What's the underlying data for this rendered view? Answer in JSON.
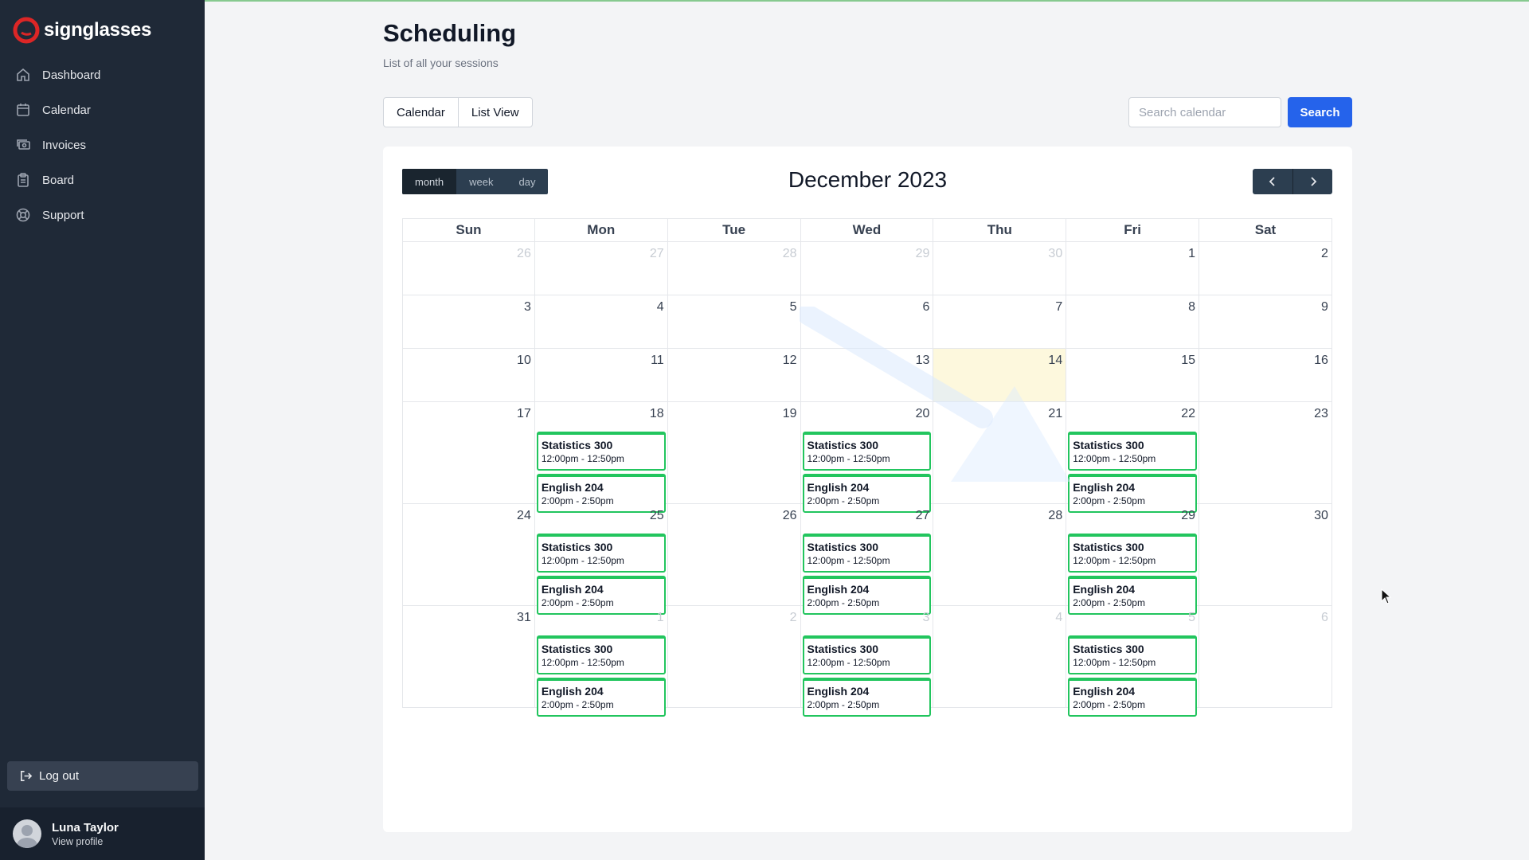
{
  "app": {
    "brand": "signglasses",
    "brand_color": "#dc2626"
  },
  "sidebar": {
    "items": [
      {
        "label": "Dashboard",
        "icon": "home-icon"
      },
      {
        "label": "Calendar",
        "icon": "calendar-icon"
      },
      {
        "label": "Invoices",
        "icon": "invoice-icon"
      },
      {
        "label": "Board",
        "icon": "clipboard-icon"
      },
      {
        "label": "Support",
        "icon": "lifebuoy-icon"
      }
    ],
    "logout_label": "Log out",
    "user": {
      "name": "Luna Taylor",
      "link": "View profile"
    }
  },
  "header": {
    "title": "Scheduling",
    "subtitle": "List of all your sessions"
  },
  "toolbar": {
    "views": [
      "Calendar",
      "List View"
    ],
    "search_placeholder": "Search calendar",
    "search_label": "Search",
    "accent": "#2563eb"
  },
  "calendar": {
    "month_title": "December 2023",
    "range_tabs": [
      "month",
      "week",
      "day"
    ],
    "active_range": "month",
    "weekdays": [
      "Sun",
      "Mon",
      "Tue",
      "Wed",
      "Thu",
      "Fri",
      "Sat"
    ],
    "today": 14,
    "event_color": "#22c55e",
    "event_types": {
      "stats": {
        "title": "Statistics 300",
        "time": "12:00pm - 12:50pm"
      },
      "english": {
        "title": "English 204",
        "time": "2:00pm - 2:50pm"
      }
    },
    "weeks": [
      [
        {
          "d": "26",
          "other": true
        },
        {
          "d": "27",
          "other": true
        },
        {
          "d": "28",
          "other": true
        },
        {
          "d": "29",
          "other": true
        },
        {
          "d": "30",
          "other": true
        },
        {
          "d": "1"
        },
        {
          "d": "2"
        }
      ],
      [
        {
          "d": "3"
        },
        {
          "d": "4"
        },
        {
          "d": "5"
        },
        {
          "d": "6"
        },
        {
          "d": "7"
        },
        {
          "d": "8"
        },
        {
          "d": "9"
        }
      ],
      [
        {
          "d": "10"
        },
        {
          "d": "11"
        },
        {
          "d": "12"
        },
        {
          "d": "13"
        },
        {
          "d": "14",
          "today": true
        },
        {
          "d": "15"
        },
        {
          "d": "16"
        }
      ],
      [
        {
          "d": "17"
        },
        {
          "d": "18",
          "ev": [
            "stats",
            "english"
          ]
        },
        {
          "d": "19"
        },
        {
          "d": "20",
          "ev": [
            "stats",
            "english"
          ]
        },
        {
          "d": "21"
        },
        {
          "d": "22",
          "ev": [
            "stats",
            "english"
          ]
        },
        {
          "d": "23"
        }
      ],
      [
        {
          "d": "24"
        },
        {
          "d": "25",
          "ev": [
            "stats",
            "english"
          ]
        },
        {
          "d": "26"
        },
        {
          "d": "27",
          "ev": [
            "stats",
            "english"
          ]
        },
        {
          "d": "28"
        },
        {
          "d": "29",
          "ev": [
            "stats",
            "english"
          ]
        },
        {
          "d": "30"
        }
      ],
      [
        {
          "d": "31"
        },
        {
          "d": "1",
          "other": true,
          "ev": [
            "stats",
            "english"
          ]
        },
        {
          "d": "2",
          "other": true
        },
        {
          "d": "3",
          "other": true,
          "ev": [
            "stats",
            "english"
          ]
        },
        {
          "d": "4",
          "other": true
        },
        {
          "d": "5",
          "other": true,
          "ev": [
            "stats",
            "english"
          ]
        },
        {
          "d": "6",
          "other": true
        }
      ]
    ]
  }
}
